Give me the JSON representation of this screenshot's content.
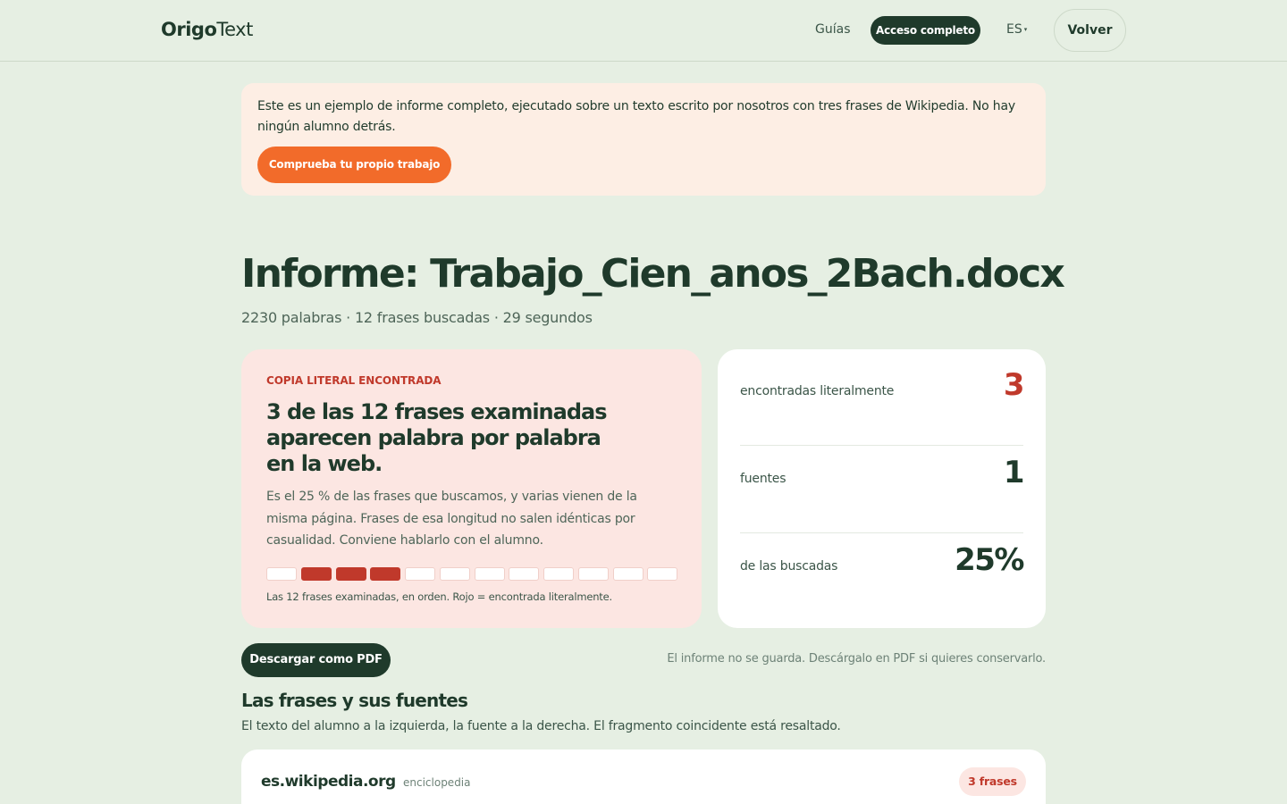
{
  "header": {
    "logo_bold": "Origo",
    "logo_light": "Text",
    "nav_guias": "Guías",
    "nav_acceso": "Acceso completo",
    "nav_lang": "ES",
    "nav_volver": "Volver"
  },
  "notice": {
    "text": "Este es un ejemplo de informe completo, ejecutado sobre un texto escrito por nosotros con tres frases de Wikipedia. No hay ningún alumno detrás.",
    "button": "Comprueba tu propio trabajo"
  },
  "report": {
    "title": "Informe: Trabajo_Cien_anos_2Bach.docx",
    "meta": "2230 palabras · 12 frases buscadas · 29 segundos"
  },
  "alert": {
    "kicker": "COPIA LITERAL ENCONTRADA",
    "headline": "3 de las 12 frases examinadas aparecen palabra por palabra en la web.",
    "body": "Es el 25 % de las frases que buscamos, y varias vienen de la misma página. Frases de esa longitud no salen idénticas por casualidad. Conviene hablarlo con el alumno.",
    "segments": [
      false,
      true,
      true,
      true,
      false,
      false,
      false,
      false,
      false,
      false,
      false,
      false
    ],
    "caption": "Las 12 frases examinadas, en orden. Rojo = encontrada literalmente.",
    "accent_color": "#c0392b"
  },
  "stats": [
    {
      "label": "encontradas literalmente",
      "value": "3",
      "highlight": true
    },
    {
      "label": "fuentes",
      "value": "1",
      "highlight": false
    },
    {
      "label": "de las buscadas",
      "value": "25%",
      "highlight": false
    }
  ],
  "actions": {
    "download": "Descargar como PDF",
    "note": "El informe no se guarda. Descárgalo en PDF si quieres conservarlo."
  },
  "sources_section": {
    "title": "Las frases y sus fuentes",
    "subtitle": "El texto del alumno a la izquierda, la fuente a la derecha. El fragmento coincidente está resaltado.",
    "items": [
      {
        "domain": "es.wikipedia.org",
        "type": "enciclopedia",
        "badge": "3 frases"
      }
    ]
  }
}
